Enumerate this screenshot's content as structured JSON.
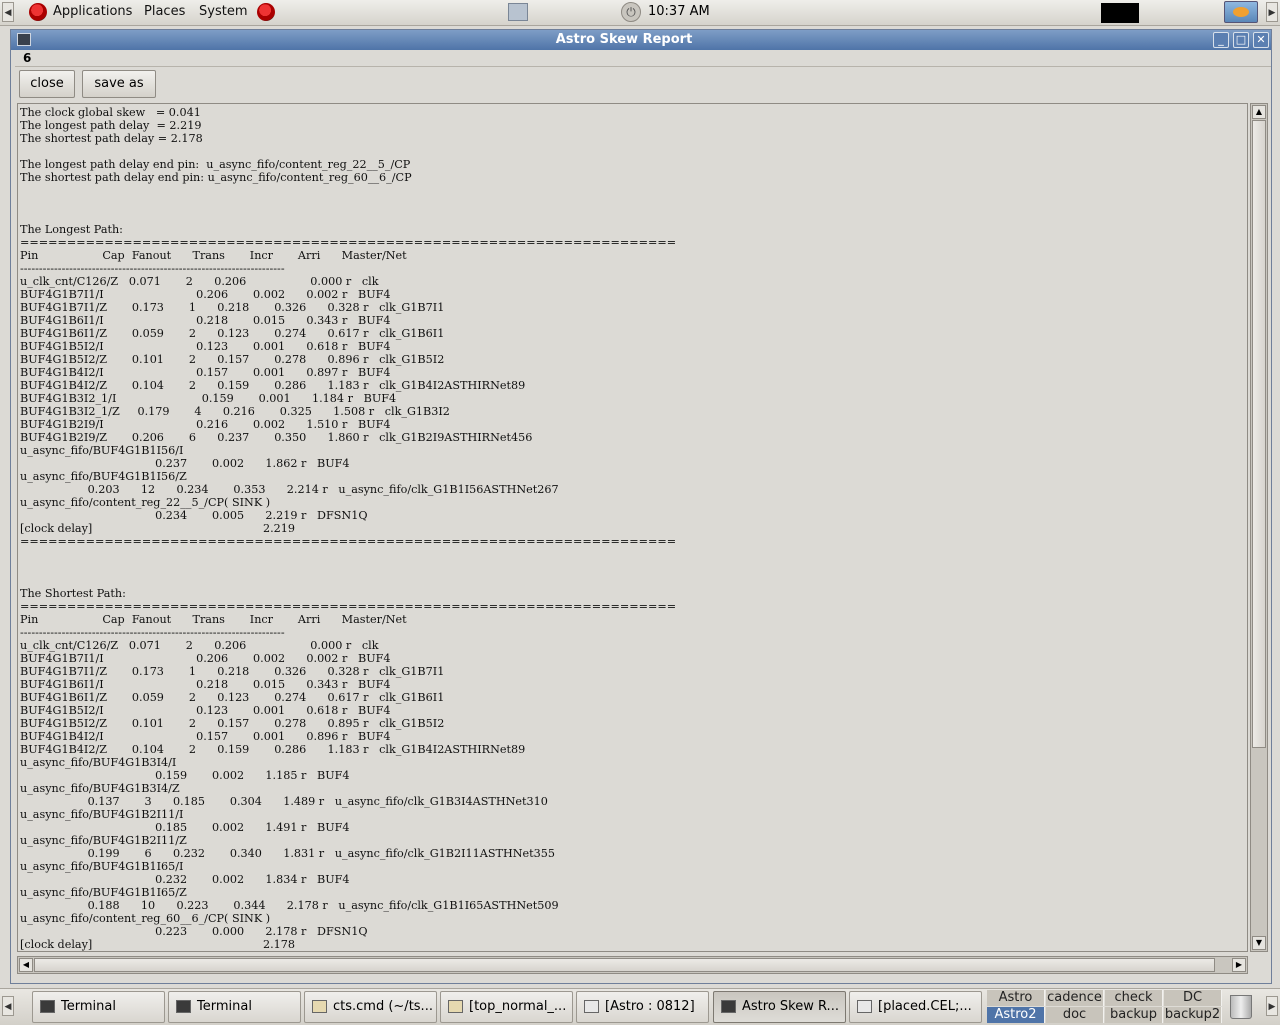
{
  "top_panel": {
    "menus": [
      "Applications",
      "Places",
      "System"
    ],
    "clock": "10:37 AM"
  },
  "window": {
    "title": "Astro Skew Report",
    "field_value": "6",
    "buttons": {
      "close": "close",
      "save_as": "save as"
    }
  },
  "report": {
    "lines": [
      "The clock global skew   = 0.041",
      "The longest path delay  = 2.219",
      "The shortest path delay = 2.178",
      "",
      "The longest path delay end pin:  u_async_fifo/content_reg_22__5_/CP",
      "The shortest path delay end pin: u_async_fifo/content_reg_60__6_/CP",
      "",
      "",
      "",
      "The Longest Path:",
      "======================================================================",
      "Pin                  Cap  Fanout      Trans       Incr       Arri      Master/Net",
      "----------------------------------------------------------------------",
      "u_clk_cnt/C126/Z   0.071       2      0.206                  0.000 r   clk",
      "BUF4G1B7I1/I                          0.206       0.002      0.002 r   BUF4",
      "BUF4G1B7I1/Z       0.173       1      0.218       0.326      0.328 r   clk_G1B7I1",
      "BUF4G1B6I1/I                          0.218       0.015      0.343 r   BUF4",
      "BUF4G1B6I1/Z       0.059       2      0.123       0.274      0.617 r   clk_G1B6I1",
      "BUF4G1B5I2/I                          0.123       0.001      0.618 r   BUF4",
      "BUF4G1B5I2/Z       0.101       2      0.157       0.278      0.896 r   clk_G1B5I2",
      "BUF4G1B4I2/I                          0.157       0.001      0.897 r   BUF4",
      "BUF4G1B4I2/Z       0.104       2      0.159       0.286      1.183 r   clk_G1B4I2ASTHIRNet89",
      "BUF4G1B3I2_1/I                        0.159       0.001      1.184 r   BUF4",
      "BUF4G1B3I2_1/Z     0.179       4      0.216       0.325      1.508 r   clk_G1B3I2",
      "BUF4G1B2I9/I                          0.216       0.002      1.510 r   BUF4",
      "BUF4G1B2I9/Z       0.206       6      0.237       0.350      1.860 r   clk_G1B2I9ASTHIRNet456",
      "u_async_fifo/BUF4G1B1I56/I",
      "                                      0.237       0.002      1.862 r   BUF4",
      "u_async_fifo/BUF4G1B1I56/Z",
      "                   0.203      12      0.234       0.353      2.214 r   u_async_fifo/clk_G1B1I56ASTHNet267",
      "u_async_fifo/content_reg_22__5_/CP( SINK )",
      "                                      0.234       0.005      2.219 r   DFSN1Q",
      "[clock delay]                                                2.219",
      "======================================================================",
      "",
      "",
      "",
      "The Shortest Path:",
      "======================================================================",
      "Pin                  Cap  Fanout      Trans       Incr       Arri      Master/Net",
      "----------------------------------------------------------------------",
      "u_clk_cnt/C126/Z   0.071       2      0.206                  0.000 r   clk",
      "BUF4G1B7I1/I                          0.206       0.002      0.002 r   BUF4",
      "BUF4G1B7I1/Z       0.173       1      0.218       0.326      0.328 r   clk_G1B7I1",
      "BUF4G1B6I1/I                          0.218       0.015      0.343 r   BUF4",
      "BUF4G1B6I1/Z       0.059       2      0.123       0.274      0.617 r   clk_G1B6I1",
      "BUF4G1B5I2/I                          0.123       0.001      0.618 r   BUF4",
      "BUF4G1B5I2/Z       0.101       2      0.157       0.278      0.895 r   clk_G1B5I2",
      "BUF4G1B4I2/I                          0.157       0.001      0.896 r   BUF4",
      "BUF4G1B4I2/Z       0.104       2      0.159       0.286      1.183 r   clk_G1B4I2ASTHIRNet89",
      "u_async_fifo/BUF4G1B3I4/I",
      "                                      0.159       0.002      1.185 r   BUF4",
      "u_async_fifo/BUF4G1B3I4/Z",
      "                   0.137       3      0.185       0.304      1.489 r   u_async_fifo/clk_G1B3I4ASTHNet310",
      "u_async_fifo/BUF4G1B2I11/I",
      "                                      0.185       0.002      1.491 r   BUF4",
      "u_async_fifo/BUF4G1B2I11/Z",
      "                   0.199       6      0.232       0.340      1.831 r   u_async_fifo/clk_G1B2I11ASTHNet355",
      "u_async_fifo/BUF4G1B1I65/I",
      "                                      0.232       0.002      1.834 r   BUF4",
      "u_async_fifo/BUF4G1B1I65/Z",
      "                   0.188      10      0.223       0.344      2.178 r   u_async_fifo/clk_G1B1I65ASTHNet509",
      "u_async_fifo/content_reg_60__6_/CP( SINK )",
      "                                      0.223       0.000      2.178 r   DFSN1Q",
      "[clock delay]                                                2.178"
    ]
  },
  "taskbar": {
    "tasks": [
      {
        "label": "Terminal",
        "icon": "terminal-icon"
      },
      {
        "label": "Terminal",
        "icon": "terminal-icon"
      },
      {
        "label": "cts.cmd (~/ts...",
        "icon": "text-editor-icon"
      },
      {
        "label": "[top_normal_...",
        "icon": "text-editor-icon"
      },
      {
        "label": "[Astro : 0812]",
        "icon": "window-icon"
      },
      {
        "label": "Astro Skew R...",
        "icon": "window-icon"
      },
      {
        "label": "[placed.CEL;...",
        "icon": "window-icon"
      }
    ],
    "workspaces_row1": [
      "Astro",
      "cadence",
      "check",
      "DC"
    ],
    "workspaces_row2": [
      "Astro2",
      "doc",
      "backup",
      "backup2"
    ]
  },
  "colors": {
    "title_bar": "#4f74a8",
    "background": "#dcdad5",
    "active_workspace": "#4f74a8"
  }
}
